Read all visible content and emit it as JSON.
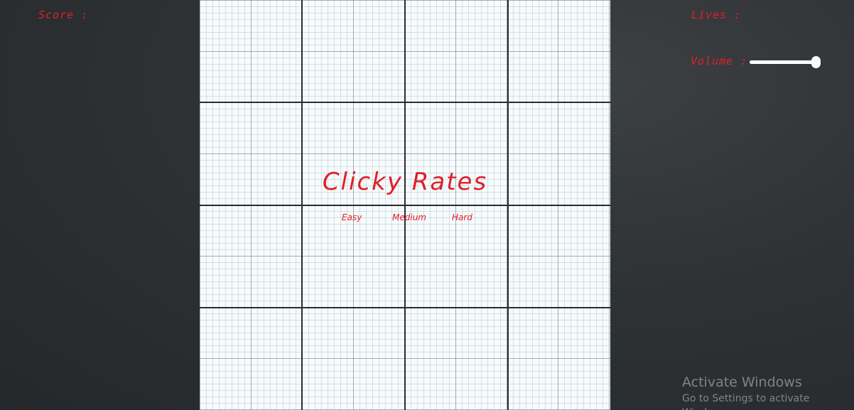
{
  "hud": {
    "score_label": "Score :",
    "lives_label": "Lives :",
    "volume_label": "Volume :",
    "volume_level": 1.0
  },
  "game": {
    "title": "Clicky Rates",
    "difficulties": [
      "Easy",
      "Medium",
      "Hard"
    ]
  },
  "watermark": {
    "title": "Activate Windows",
    "subtitle": "Go to Settings to activate Windows."
  },
  "colors": {
    "accent": "#e0202a",
    "background": "#2f3235",
    "board": "#f7fbfc",
    "grid_major": "#2a2d30"
  }
}
